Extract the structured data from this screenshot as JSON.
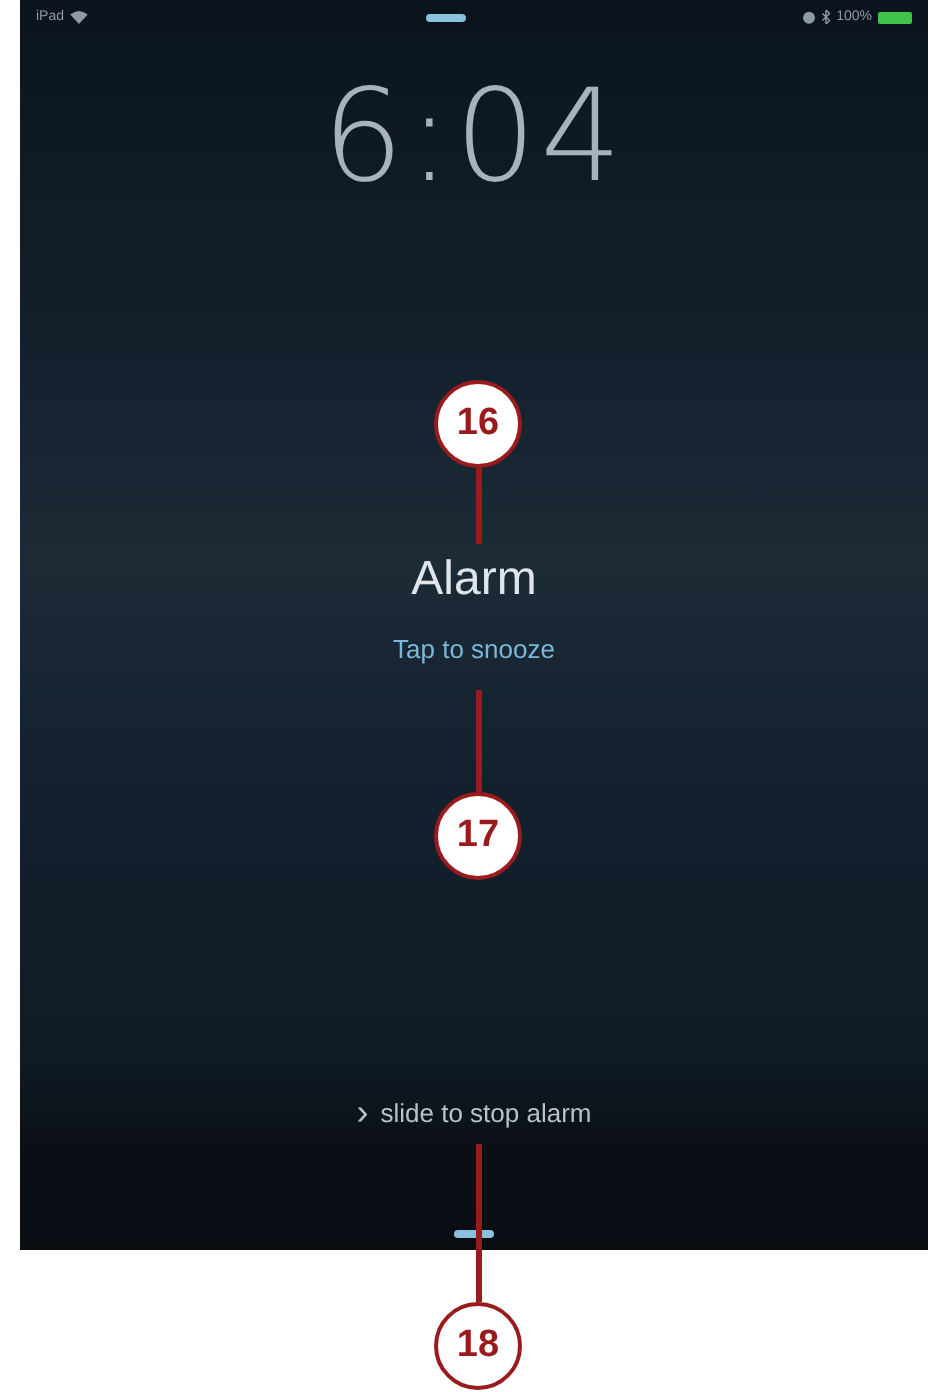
{
  "status_bar": {
    "device": "iPad",
    "battery": "100%"
  },
  "time": "6:04",
  "alarm": {
    "title": "Alarm",
    "action": "Tap to snooze"
  },
  "unlock_hint": {
    "arrow": "›",
    "text": "slide to stop alarm"
  },
  "callouts": [
    "16",
    "17",
    "18"
  ]
}
